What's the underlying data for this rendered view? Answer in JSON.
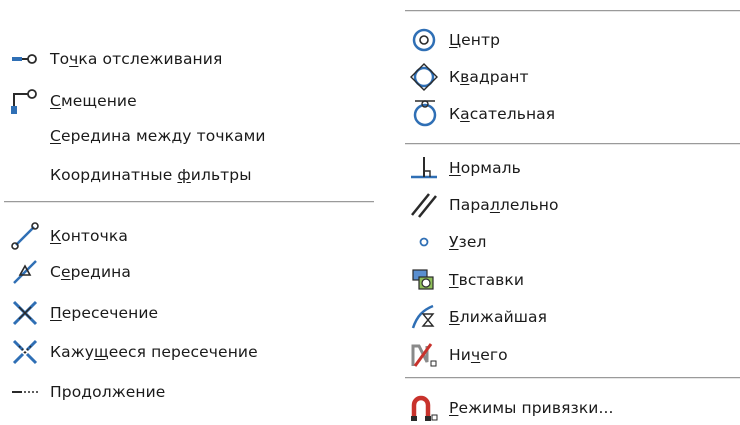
{
  "left_menu": {
    "group1": [
      {
        "id": "tracking-point",
        "icon": "tracking-point-icon",
        "pre": "То",
        "u": "ч",
        "post": "ка отслеживания"
      },
      {
        "id": "offset",
        "icon": "offset-icon",
        "pre": "",
        "u": "С",
        "post": "мещение"
      },
      {
        "id": "midpoint-between-points",
        "icon": "",
        "pre": "",
        "u": "С",
        "post": "ередина между точками"
      },
      {
        "id": "coordinate-filters",
        "icon": "",
        "pre": "Координатные ",
        "u": "ф",
        "post": "ильтры"
      }
    ],
    "group2": [
      {
        "id": "endpoint",
        "icon": "endpoint-icon",
        "pre": "",
        "u": "К",
        "post": "онточка"
      },
      {
        "id": "midpoint",
        "icon": "midpoint-icon",
        "pre": "С",
        "u": "е",
        "post": "редина"
      },
      {
        "id": "intersection",
        "icon": "intersection-icon",
        "pre": "",
        "u": "П",
        "post": "ересечение"
      },
      {
        "id": "apparent-intersection",
        "icon": "apparent-intersection-icon",
        "pre": "Кажу",
        "u": "щ",
        "post": "ееся пересечение"
      },
      {
        "id": "extension",
        "icon": "extension-icon",
        "pre": "Про",
        "u": "д",
        "post": "олжение"
      }
    ]
  },
  "right_menu": {
    "group1": [
      {
        "id": "center",
        "icon": "center-icon",
        "pre": "",
        "u": "Ц",
        "post": "ентр"
      },
      {
        "id": "quadrant",
        "icon": "quadrant-icon",
        "pre": "К",
        "u": "в",
        "post": "адрант"
      },
      {
        "id": "tangent",
        "icon": "tangent-icon",
        "pre": "К",
        "u": "а",
        "post": "сательная"
      }
    ],
    "group2": [
      {
        "id": "perpendicular",
        "icon": "perpendicular-icon",
        "pre": "",
        "u": "Н",
        "post": "ормаль"
      },
      {
        "id": "parallel",
        "icon": "parallel-icon",
        "pre": "Пара",
        "u": "л",
        "post": "лельно"
      },
      {
        "id": "node",
        "icon": "node-icon",
        "pre": "",
        "u": "У",
        "post": "зел"
      },
      {
        "id": "insert",
        "icon": "insert-icon",
        "pre": "",
        "u": "Т",
        "post": "вставки"
      },
      {
        "id": "nearest",
        "icon": "nearest-icon",
        "pre": "",
        "u": "Б",
        "post": "лижайшая"
      },
      {
        "id": "none",
        "icon": "none-icon",
        "pre": "Ни",
        "u": "ч",
        "post": "его"
      }
    ],
    "group3": [
      {
        "id": "osnap-settings",
        "icon": "osnap-settings-icon",
        "pre": "",
        "u": "Р",
        "post": "ежимы привязки..."
      }
    ]
  },
  "colors": {
    "icon_blue": "#2f6fb5",
    "icon_dark": "#2a2a2a",
    "icon_red": "#c8322c",
    "separator": "#9a9a9a"
  }
}
